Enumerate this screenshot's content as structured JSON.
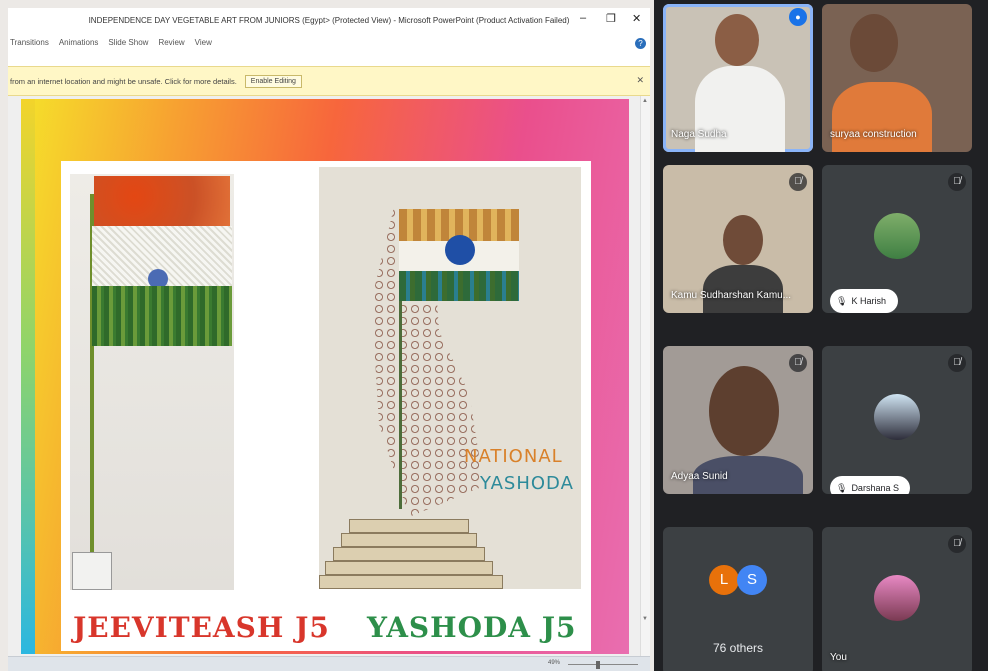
{
  "ppt": {
    "window_title": "INDEPENDENCE DAY VEGETABLE ART FROM JUNIORS (Egypt> (Protected View) - Microsoft PowerPoint (Product Activation Failed)",
    "minimize": "–",
    "restore": "❐",
    "close": "✕",
    "menu": [
      "Transitions",
      "Animations",
      "Slide Show",
      "Review",
      "View"
    ],
    "help": "?",
    "protected_view_message": "from an internet location and might be unsafe. Click for more details.",
    "enable_editing": "Enable Editing",
    "protected_close": "✕",
    "zoom_label": "49%"
  },
  "slide": {
    "art2_text_line1": "NATIONAL",
    "art2_text_line2": "YASHODA",
    "caption_left": "JEEVITEASH J5",
    "caption_right": "YASHODA J5"
  },
  "meet": {
    "tiles": [
      {
        "name": "Naga Sudha"
      },
      {
        "name": "suryaa construction"
      },
      {
        "name": "Kamu Sudharshan Kamu..."
      },
      {
        "name": "K Harish"
      },
      {
        "name": "Adyaa Sunid"
      },
      {
        "name": "Darshana S"
      },
      {
        "name": "76 others",
        "bubble1": "L",
        "bubble2": "S"
      },
      {
        "name": "You"
      }
    ],
    "mic_off_icon": "🎙̸",
    "colors": {
      "bubble_l": "#e8710a",
      "bubble_s": "#4285f4",
      "active_border": "#8ab4f8"
    }
  }
}
